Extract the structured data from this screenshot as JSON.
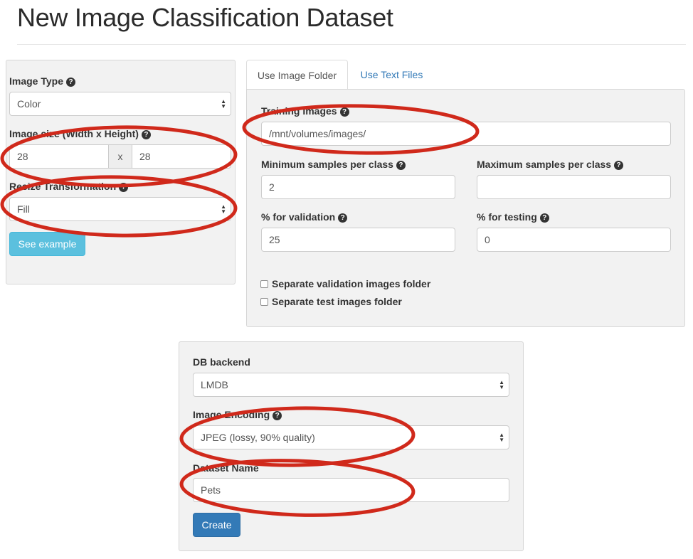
{
  "page": {
    "title": "New Image Classification Dataset"
  },
  "left_panel": {
    "image_type": {
      "label": "Image Type",
      "value": "Color"
    },
    "image_size": {
      "label": "Image size (Width x Height)",
      "width": "28",
      "separator": "x",
      "height": "28"
    },
    "resize": {
      "label": "Resize Transformation",
      "value": "Fill"
    },
    "see_example_label": "See example"
  },
  "tabs": [
    {
      "label": "Use Image Folder",
      "active": true
    },
    {
      "label": "Use Text Files",
      "active": false
    }
  ],
  "folder_panel": {
    "training_images": {
      "label": "Training Images",
      "value": "/mnt/volumes/images/"
    },
    "min_samples": {
      "label": "Minimum samples per class",
      "value": "2"
    },
    "max_samples": {
      "label": "Maximum samples per class",
      "value": ""
    },
    "pct_validation": {
      "label": "% for validation",
      "value": "25"
    },
    "pct_testing": {
      "label": "% for testing",
      "value": "0"
    },
    "separate_validation_label": "Separate validation images folder",
    "separate_test_label": "Separate test images folder"
  },
  "bottom_panel": {
    "db_backend": {
      "label": "DB backend",
      "value": "LMDB"
    },
    "image_encoding": {
      "label": "Image Encoding",
      "value": "JPEG (lossy, 90% quality)"
    },
    "dataset_name": {
      "label": "Dataset Name",
      "value": "Pets"
    },
    "create_label": "Create"
  },
  "help_icon": "?",
  "select_arrow_icons": [
    "▲",
    "▼"
  ],
  "colors": {
    "annotation_red": "#d0291b",
    "primary_button": "#337ab7",
    "info_button": "#5bc0de",
    "link": "#337ab7"
  }
}
